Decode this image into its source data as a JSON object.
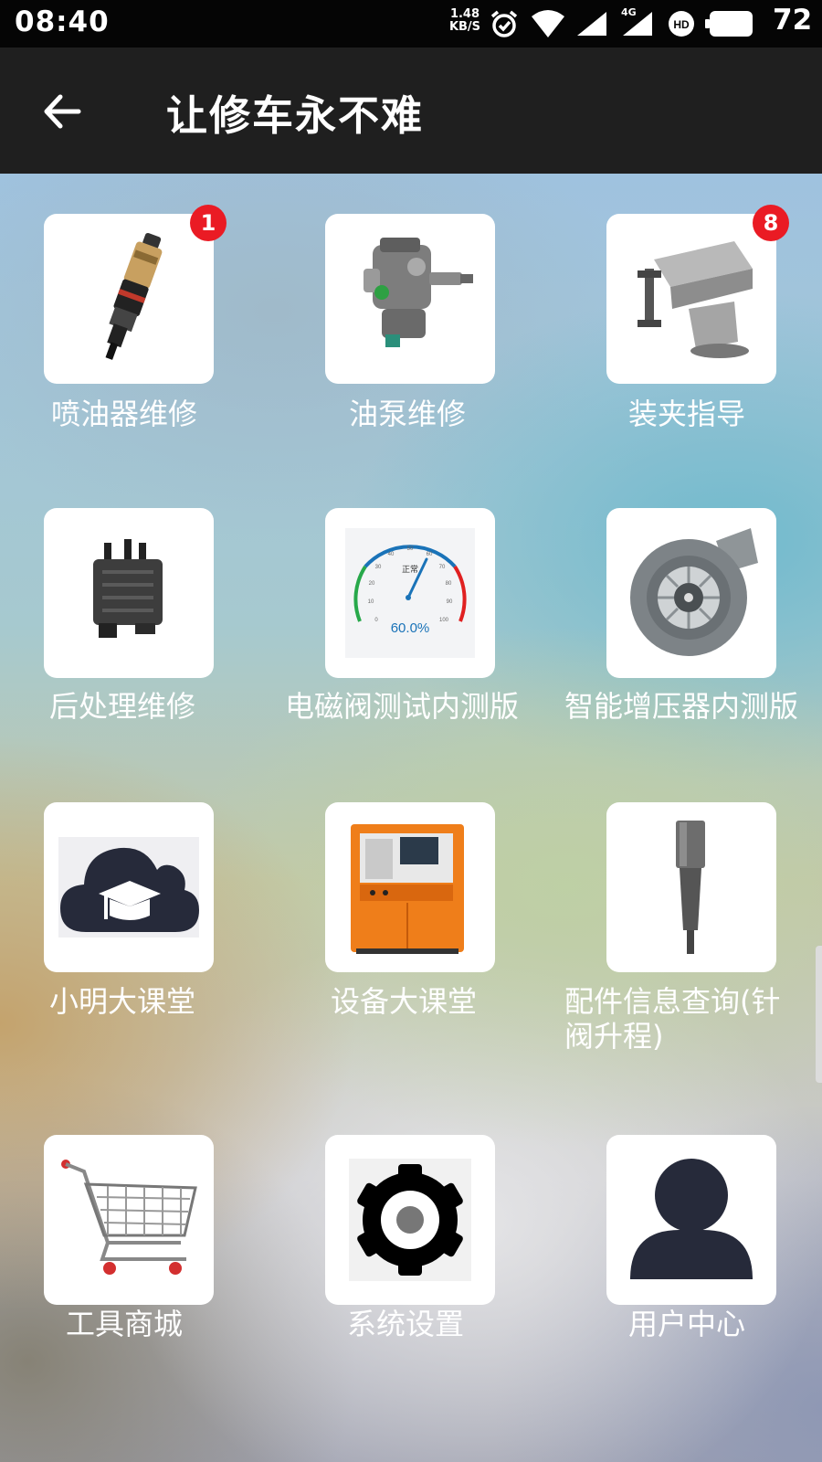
{
  "status_bar": {
    "time": "08:40",
    "net_speed_value": "1.48",
    "net_speed_unit": "KB/S",
    "network_type": "4G",
    "battery_percent": "72",
    "icons": [
      "alarm-icon",
      "wifi-icon",
      "signal-icon",
      "signal-4g-icon",
      "hd-icon",
      "battery-icon"
    ]
  },
  "app_bar": {
    "back_icon": "arrow-left-icon",
    "title": "让修车永不难"
  },
  "grid": {
    "items": [
      {
        "label": "喷油器维修",
        "icon": "fuel-injector-icon",
        "badge": "1"
      },
      {
        "label": "油泵维修",
        "icon": "fuel-pump-icon",
        "badge": ""
      },
      {
        "label": "装夹指导",
        "icon": "bench-vise-icon",
        "badge": "8"
      },
      {
        "label": "后处理维修",
        "icon": "aftertreatment-module-icon",
        "badge": ""
      },
      {
        "label": "电磁阀测试内测版",
        "icon": "gauge-icon",
        "badge": "",
        "gauge_text": "正常",
        "gauge_value": "60.0%",
        "gauge_ticks": [
          "0",
          "10",
          "20",
          "30",
          "40",
          "50",
          "60",
          "70",
          "80",
          "90",
          "100"
        ]
      },
      {
        "label": "智能增压器内测版",
        "icon": "turbocharger-icon",
        "badge": ""
      },
      {
        "label": "小明大课堂",
        "icon": "cloud-graduation-cap-icon",
        "badge": ""
      },
      {
        "label": "设备大课堂",
        "icon": "test-bench-machine-icon",
        "badge": ""
      },
      {
        "label": "配件信息查询(针阀升程)",
        "icon": "injector-nozzle-icon",
        "badge": ""
      },
      {
        "label": "工具商城",
        "icon": "shopping-cart-icon",
        "badge": ""
      },
      {
        "label": "系统设置",
        "icon": "gear-icon",
        "badge": ""
      },
      {
        "label": "用户中心",
        "icon": "user-icon",
        "badge": ""
      }
    ]
  },
  "colors": {
    "status_bar_bg": "#050505",
    "app_bar_bg": "#1f1f1f",
    "badge": "#ea1b24",
    "tile_bg": "#ffffff",
    "icon_dark": "#262a3a"
  }
}
